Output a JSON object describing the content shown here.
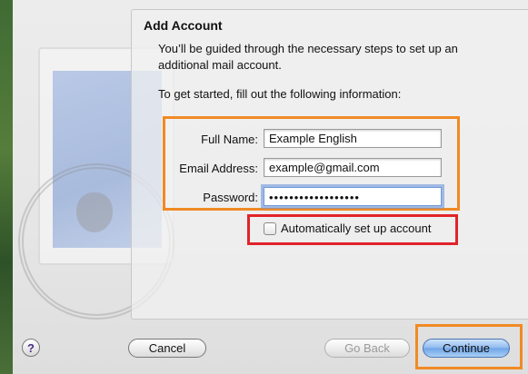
{
  "dialog": {
    "title": "Add Account",
    "intro": "You’ll be guided through the necessary steps to set up an additional mail account.",
    "prompt": "To get started, fill out the following information:"
  },
  "form": {
    "full_name_label": "Full Name:",
    "full_name_value": "Example English",
    "email_label": "Email Address:",
    "email_value": "example@gmail.com",
    "password_label": "Password:",
    "password_value": "••••••••••••••••••",
    "auto_setup_label": "Automatically set up account",
    "auto_setup_checked": false
  },
  "buttons": {
    "help": "?",
    "cancel": "Cancel",
    "back": "Go Back",
    "continue": "Continue"
  },
  "colors": {
    "annotation_orange": "#f08a24",
    "annotation_red": "#e0242a",
    "primary_blue": "#6ea3e6"
  },
  "icons": {
    "artwork": "mail-stamp-icon",
    "help": "help-icon"
  }
}
